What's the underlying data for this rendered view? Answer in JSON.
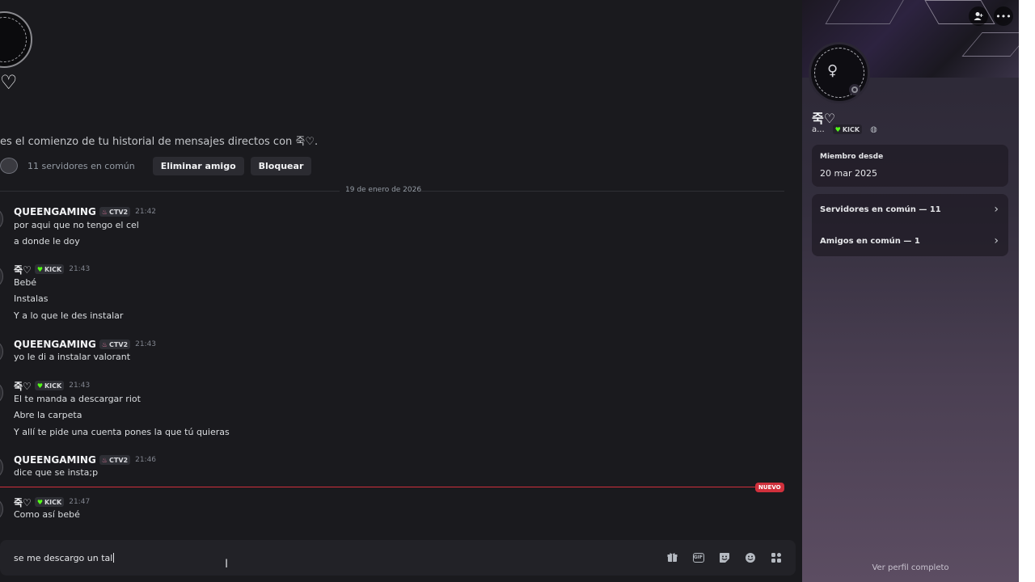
{
  "dm": {
    "name": "죽♡",
    "intro": "es el comienzo de tu historial de mensajes directos con 죽♡.",
    "mutual_servers": "11 servidores en común",
    "remove_friend": "Eliminar amigo",
    "block": "Bloquear"
  },
  "divider_date": "19 de enero de 2026",
  "messages": [
    {
      "author": "QUEENGAMING",
      "tag": "CTV2",
      "time": "21:42",
      "lines": [
        "por aqui que no tengo el cel",
        "a donde le doy"
      ]
    },
    {
      "author": "죽♡",
      "tag": "KICK",
      "time": "21:43",
      "lines": [
        "Bebé",
        "Instalas",
        "Y a lo que le des instalar"
      ]
    },
    {
      "author": "QUEENGAMING",
      "tag": "CTV2",
      "time": "21:43",
      "lines": [
        "yo le di a instalar valorant"
      ]
    },
    {
      "author": "죽♡",
      "tag": "KICK",
      "time": "21:43",
      "lines": [
        "El te manda a descargar riot",
        "Abre la carpeta",
        "Y allí te pide una cuenta pones la que tú quieras"
      ]
    },
    {
      "author": "QUEENGAMING",
      "tag": "CTV2",
      "time": "21:46",
      "lines": [
        "dice que se insta;p"
      ]
    },
    {
      "author": "죽♡",
      "tag": "KICK",
      "time": "21:47",
      "lines": [
        "Como así bebé"
      ]
    }
  ],
  "new_label": "NUEVO",
  "composer": {
    "value": "se me descargo un tal"
  },
  "composer_icons": [
    "gift-icon",
    "gif-icon",
    "sticker-icon",
    "emoji-icon",
    "apps-icon"
  ],
  "profile": {
    "name": "죽♡",
    "username": "a...",
    "tag": "KICK",
    "member_since_label": "Miembro desde",
    "member_since": "20 mar 2025",
    "mutual_servers": "Servidores en común — 11",
    "mutual_friends": "Amigos en común — 1",
    "view_full": "Ver perfil completo"
  },
  "colors": {
    "kick": "#53fc18",
    "ctv2": "#f47fa8",
    "new": "#d0303c"
  }
}
